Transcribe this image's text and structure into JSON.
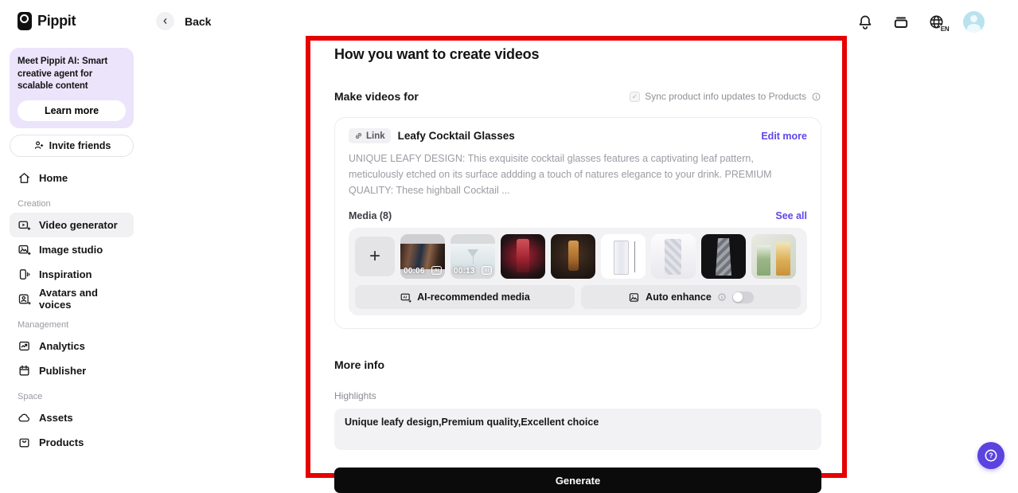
{
  "brand": {
    "name": "Pippit"
  },
  "header": {
    "back_label": "Back",
    "language": "EN",
    "icons": [
      "bell-icon",
      "billing-cards-icon",
      "globe-language-icon",
      "user-avatar"
    ]
  },
  "sidebar": {
    "promo": {
      "text": "Meet Pippit AI: Smart creative agent for scalable content",
      "button_label": "Learn more"
    },
    "invite_label": "Invite friends",
    "sections": [
      {
        "label": "",
        "items": [
          {
            "label": "Home",
            "icon": "home",
            "active": false
          }
        ]
      },
      {
        "label": "Creation",
        "items": [
          {
            "label": "Video generator",
            "icon": "video-plus",
            "active": true
          },
          {
            "label": "Image studio",
            "icon": "image-plus",
            "active": false
          },
          {
            "label": "Inspiration",
            "icon": "inspiration",
            "active": false
          },
          {
            "label": "Avatars and voices",
            "icon": "avatars",
            "active": false
          }
        ]
      },
      {
        "label": "Management",
        "items": [
          {
            "label": "Analytics",
            "icon": "analytics",
            "active": false
          },
          {
            "label": "Publisher",
            "icon": "publisher",
            "active": false
          }
        ]
      },
      {
        "label": "Space",
        "items": [
          {
            "label": "Assets",
            "icon": "assets",
            "active": false
          },
          {
            "label": "Products",
            "icon": "products",
            "active": false
          }
        ]
      }
    ]
  },
  "main": {
    "title": "How you want to create videos",
    "make_videos_for": "Make videos for",
    "sync_label": "Sync product info updates to Products",
    "sync_checked": true,
    "product": {
      "badge": "Link",
      "name": "Leafy Cocktail Glasses",
      "edit_more": "Edit more",
      "description": "UNIQUE LEAFY DESIGN: This exquisite cocktail glasses features a captivating leaf pattern, meticulously etched on its surface addding a touch of natures elegance to your drink. PREMIUM QUALITY: These highball Cocktail ..."
    },
    "media": {
      "label": "Media (8)",
      "see_all": "See all",
      "ai_recommended_label": "AI-recommended media",
      "auto_enhance_label": "Auto enhance",
      "auto_enhance_on": false,
      "items": [
        {
          "kind": "video",
          "duration": "00:06",
          "desc": "dark bar scene video"
        },
        {
          "kind": "video",
          "duration": "00:13",
          "desc": "martini glass video"
        },
        {
          "kind": "image",
          "desc": "red cocktail on dark background"
        },
        {
          "kind": "image",
          "desc": "amber cocktail on dark background"
        },
        {
          "kind": "image",
          "desc": "glass dimensions spec on white"
        },
        {
          "kind": "image",
          "desc": "crystal glass on white"
        },
        {
          "kind": "image",
          "desc": "crystal glass on black"
        },
        {
          "kind": "image",
          "desc": "two garnished cocktails"
        }
      ]
    },
    "more_info": "More info",
    "highlights_label": "Highlights",
    "highlights_value": "Unique leafy design,Premium quality,Excellent choice",
    "generate_label": "Generate"
  },
  "colors": {
    "accent_purple": "#5e47eb",
    "annotation_red": "#e60000",
    "promo_bg": "#ece4fb",
    "avatar_bg": "#b9e2ee",
    "help_fab": "#5b43df",
    "generate_bg": "#0b0b0c"
  }
}
